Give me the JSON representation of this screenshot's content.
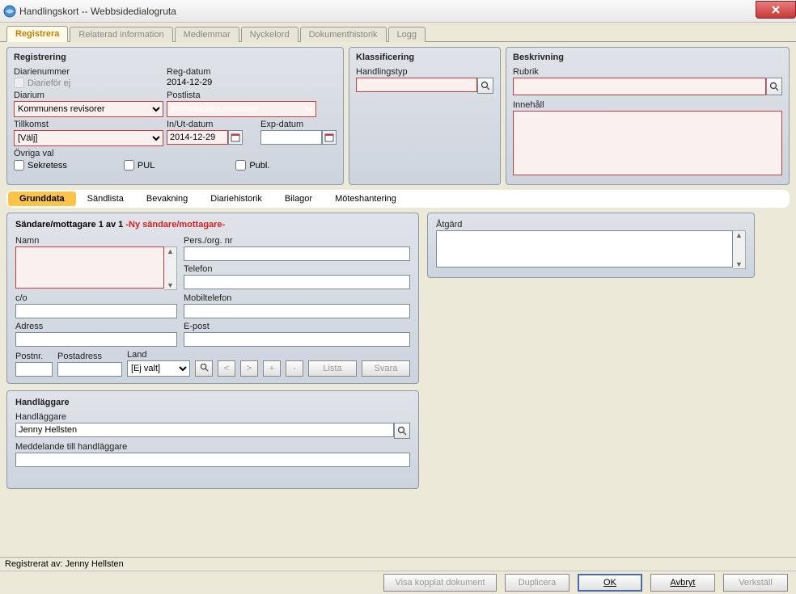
{
  "window": {
    "title": "Handlingskort -- Webbsidedialogruta",
    "close": "X"
  },
  "tabs": {
    "registrera": "Registrera",
    "relaterad": "Relaterad information",
    "medlemmar": "Medlemmar",
    "nyckelord": "Nyckelord",
    "dokhist": "Dokumenthistorik",
    "logg": "Logg"
  },
  "reg": {
    "title": "Registrering",
    "diarienummer_label": "Diarienummer",
    "diariefor_ej": "Diarieför ej",
    "regdatum_label": "Reg-datum",
    "regdatum_value": "2014-12-29",
    "diarium_label": "Diarium",
    "diarium_value": "Kommunens revisorer",
    "postlista_label": "Postlista",
    "postlista_value": "Kommunens revisorer",
    "tillkomst_label": "Tillkomst",
    "tillkomst_value": "[Välj]",
    "inut_label": "In/Ut-datum",
    "inut_value": "2014-12-29",
    "exp_label": "Exp-datum",
    "exp_value": "",
    "ovriga_label": "Övriga val",
    "sekretess": "Sekretess",
    "pul": "PUL",
    "publ": "Publ."
  },
  "klass": {
    "title": "Klassificering",
    "handlingstyp_label": "Handlingstyp",
    "handlingstyp_value": ""
  },
  "beskr": {
    "title": "Beskrivning",
    "rubrik_label": "Rubrik",
    "rubrik_value": "",
    "innehall_label": "Innehåll",
    "innehall_value": ""
  },
  "subtabs": {
    "grunddata": "Grunddata",
    "sandlista": "Sändlista",
    "bevakning": "Bevakning",
    "diariehistorik": "Diariehistorik",
    "bilagor": "Bilagor",
    "moteshantering": "Möteshantering"
  },
  "sandare": {
    "title_prefix": "Sändare/mottagare 1 av 1 ",
    "title_suffix": "-Ny sändare/mottagare-",
    "namn_label": "Namn",
    "namn_value": "",
    "pers_label": "Pers./org. nr",
    "pers_value": "",
    "telefon_label": "Telefon",
    "telefon_value": "",
    "co_label": "c/o",
    "co_value": "",
    "mobil_label": "Mobiltelefon",
    "mobil_value": "",
    "adress_label": "Adress",
    "adress_value": "",
    "epost_label": "E-post",
    "epost_value": "",
    "postnr_label": "Postnr.",
    "postnr_value": "",
    "postadress_label": "Postadress",
    "postadress_value": "",
    "land_label": "Land",
    "land_value": "[Ej valt]",
    "btn_prev": "<",
    "btn_next": ">",
    "btn_plus": "+",
    "btn_minus": "-",
    "btn_lista": "Lista",
    "btn_svara": "Svara"
  },
  "atgard": {
    "label": "Åtgärd",
    "value": ""
  },
  "handlaggare": {
    "panel_title": "Handläggare",
    "label": "Handläggare",
    "value": "Jenny Hellsten",
    "meddelande_label": "Meddelande till handläggare",
    "meddelande_value": ""
  },
  "footer": {
    "registered_by": "Registrerat av: Jenny Hellsten",
    "visa_kopplat": "Visa kopplat dokument",
    "duplicera": "Duplicera",
    "ok": "OK",
    "avbryt": "Avbryt",
    "verkstall": "Verkställ"
  }
}
